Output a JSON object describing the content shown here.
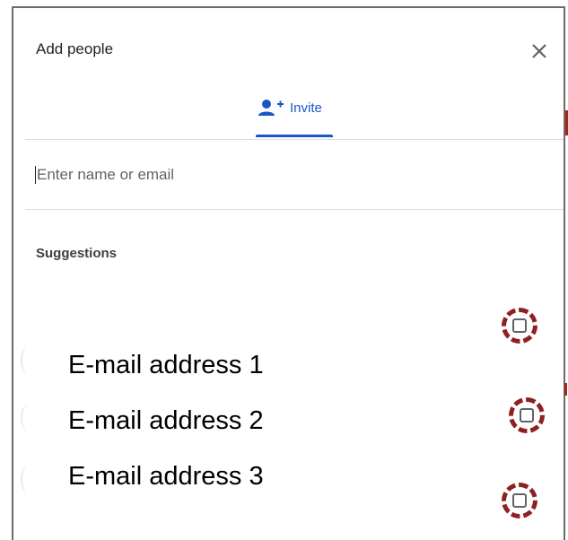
{
  "dialog": {
    "title": "Add people",
    "close_icon": "close-icon"
  },
  "tabs": [
    {
      "label": "Invite",
      "icon": "person-add-icon",
      "active": true
    }
  ],
  "search": {
    "placeholder": "Enter name or email",
    "value": ""
  },
  "suggestions": {
    "label": "Suggestions",
    "items": [
      {
        "email": "E-mail address 1",
        "checked": false
      },
      {
        "email": "E-mail address 2",
        "checked": false
      },
      {
        "email": "E-mail address 3",
        "checked": false
      }
    ]
  },
  "colors": {
    "accent": "#1a56c8",
    "highlight_ring": "#8e2020",
    "divider": "#dadce0"
  }
}
